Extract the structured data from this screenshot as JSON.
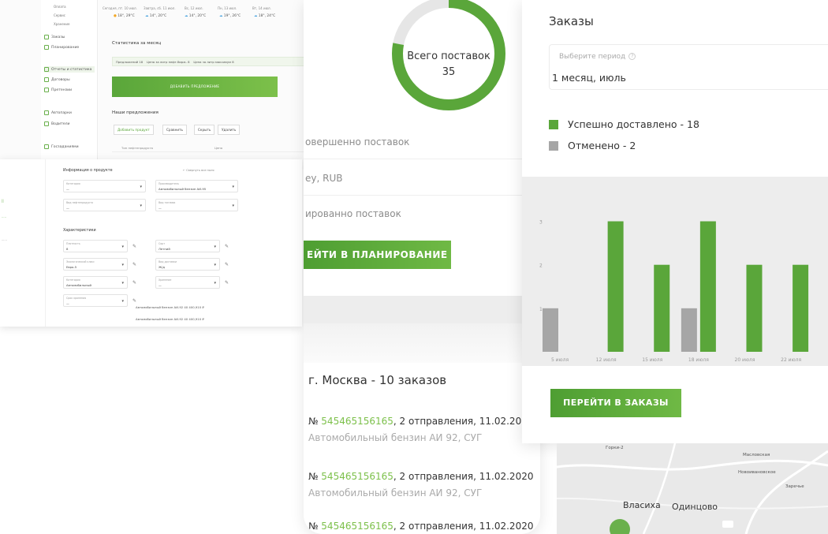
{
  "back_dashboard": {
    "sidebar": [
      "Оплата",
      "Сервис",
      "Хранение",
      "Заказы",
      "Планирование",
      "Отчеты и статистика",
      "Договоры",
      "Претензии",
      "Автопарки",
      "Водители",
      "Госзаданиями"
    ],
    "weather": {
      "labels": [
        "Сегодня, пт. 10 июл.",
        "Завтра, сб. 11 июл.",
        "Вс, 12 июл.",
        "Пн, 13 июл.",
        "Вт, 14 июл."
      ],
      "values": [
        "18°, 29°С",
        "14°, 20°С",
        "14°, 20°С",
        "19°, 26°С",
        "18°, 24°С"
      ]
    },
    "stats_title": "Статистика за месяц",
    "chips": [
      "Предложений  18",
      "Цена за литр нефт.бирж.  8",
      "Цена за литр максимум  8"
    ],
    "add_offer": "ДОБАВИТЬ ПРЕДЛОЖЕНИЕ",
    "offers_title": "Наши предложения",
    "actions": [
      "Добавить продукт",
      "Сравнить",
      "Скрыть",
      "Удалить"
    ],
    "table_header": [
      "Тип нефтепродукта",
      "Цена"
    ]
  },
  "product_card": {
    "info_title": "Информация о продукте",
    "hide_link": "← Свернуть все поля",
    "fields": [
      {
        "label": "Категория",
        "value": "—"
      },
      {
        "label": "Производитель",
        "value": "Автомобильный бензин АИ-95"
      },
      {
        "label": "Вид нефтепродукта",
        "value": "—"
      },
      {
        "label": "Вид топлива",
        "value": "—"
      }
    ],
    "chars_title": "Характеристики",
    "chars": [
      {
        "label": "Плотность",
        "value": "8"
      },
      {
        "label": "Сорт",
        "value": "Летний"
      },
      {
        "label": "Экологический класс",
        "value": "Евро-5"
      },
      {
        "label": "Вид доставки",
        "value": "Ж/д"
      },
      {
        "label": "Категория",
        "value": "Автомобильный"
      },
      {
        "label": "Хранение",
        "value": "—"
      },
      {
        "label": "Срок хранения",
        "value": "—"
      }
    ],
    "rows": [
      "Автомобильный бензин АИ-92   40 400,910 ₽",
      "Автомобильный бензин АИ-92   40 400,910 ₽"
    ]
  },
  "middle": {
    "donut": {
      "label": "Всего поставок",
      "total": "35",
      "completed_share": 0.78
    },
    "stats": [
      "овершенно поставок",
      "еу, RUB",
      "ированно поставок"
    ],
    "plan_button": "ЕЙТИ В ПЛАНИРОВАНИЕ",
    "city": "г. Москва - 10 заказов",
    "orders": [
      {
        "prefix": "№ ",
        "number": "545465156165",
        "rest": ", 2 отправления, 11.02.2020",
        "product": "Автомобильный бензин АИ 92, СУГ"
      },
      {
        "prefix": "№ ",
        "number": "545465156165",
        "rest": ", 2 отправления, 11.02.2020",
        "product": "Автомобильный бензин АИ 92, СУГ"
      },
      {
        "prefix": "№ ",
        "number": "545465156165",
        "rest": ", 2 отправления, 11.02.2020",
        "product": ""
      }
    ]
  },
  "orders_panel": {
    "title": "Заказы",
    "period_label": "Выберите период",
    "period_value": "1 месяц, июль",
    "legend": [
      {
        "label": "Успешно доставлено - 18",
        "color": "#5aa63a"
      },
      {
        "label": "Отменено - 2",
        "color": "#a6a6a6"
      }
    ],
    "button": "ПЕРЕЙТИ В ЗАКАЗЫ"
  },
  "chart_data": {
    "type": "bar",
    "categories": [
      "5 июля",
      "12 июля",
      "15 июля",
      "18 июля",
      "20 июля",
      "22 июля"
    ],
    "series": [
      {
        "name": "Успешно доставлено",
        "values": [
          0,
          3,
          2,
          3,
          2,
          2
        ],
        "color": "#5aa63a"
      },
      {
        "name": "Отменено",
        "values": [
          1,
          0,
          0,
          1,
          0,
          0
        ],
        "color": "#a6a6a6"
      }
    ],
    "yticks": [
      1,
      2,
      3
    ],
    "ylim": [
      0,
      3.3
    ]
  },
  "map": {
    "labels": [
      "Горки-2",
      "Масловская",
      "Новоивановское",
      "Заречье"
    ],
    "cities": [
      "Власиха",
      "Одинцово"
    ]
  }
}
